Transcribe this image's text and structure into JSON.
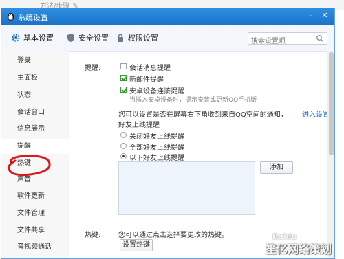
{
  "background": {
    "title": "方法/步骤"
  },
  "window": {
    "title": "系统设置"
  },
  "tabs": [
    {
      "label": "基本设置"
    },
    {
      "label": "安全设置"
    },
    {
      "label": "权限设置"
    }
  ],
  "search": {
    "placeholder": "搜索设置项"
  },
  "sidebar": {
    "items": [
      {
        "label": "登录"
      },
      {
        "label": "主面板"
      },
      {
        "label": "状态"
      },
      {
        "label": "会话窗口"
      },
      {
        "label": "信息展示"
      },
      {
        "label": "提醒"
      },
      {
        "label": "热键"
      },
      {
        "label": "声音"
      },
      {
        "label": "软件更新"
      },
      {
        "label": "文件管理"
      },
      {
        "label": "文件共享"
      },
      {
        "label": "音视频通话"
      }
    ]
  },
  "reminder": {
    "section_label": "提醒:",
    "options": [
      {
        "label": "会话消息提醒",
        "checked": false
      },
      {
        "label": "新邮件提醒",
        "checked": true
      },
      {
        "label": "安卓设备连接提醒",
        "checked": true
      }
    ],
    "android_hint": "当插入安卓设备时，提示安装或更新QQ手机版",
    "notice_text": "您可以设置是否在屏幕右下角收到来自QQ空间的通知，",
    "notice_link": "进入设置。",
    "friend_online_title": "好友上线提醒",
    "radios": [
      {
        "label": "关闭好友上线提醒",
        "checked": false
      },
      {
        "label": "全部好友上线提醒",
        "checked": false
      },
      {
        "label": "以下好友上线提醒",
        "checked": true
      }
    ],
    "add_button": "添加"
  },
  "hotkey": {
    "section_label": "热键:",
    "desc": "您可以通过点击选择要更改的热键。",
    "button": "设置热键"
  },
  "watermark": {
    "text": "笙亿网络策划",
    "small": "Baidu"
  }
}
